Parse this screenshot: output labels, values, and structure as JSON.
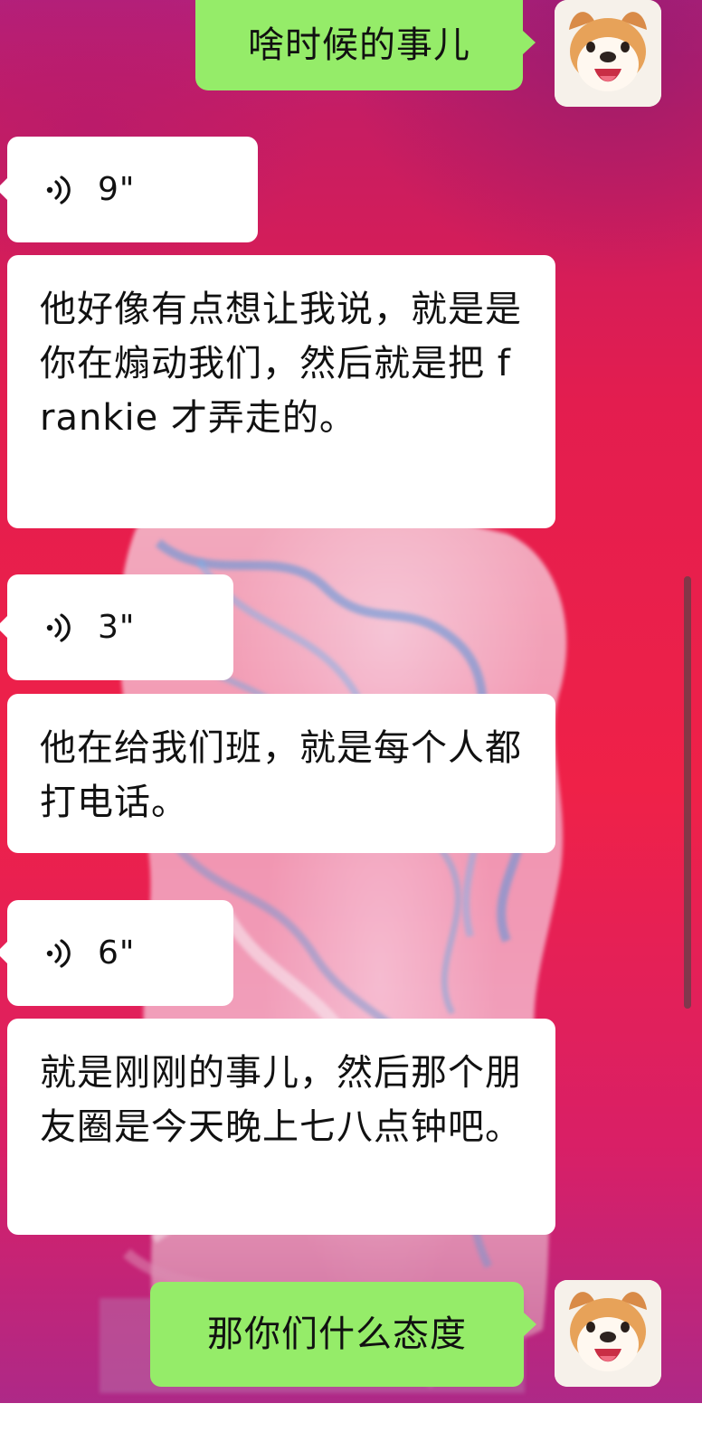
{
  "colors": {
    "outgoing_bubble": "#95ec69",
    "incoming_bubble": "#ffffff"
  },
  "conversation": {
    "messages": [
      {
        "id": "msg-out-1",
        "kind": "outgoing-text",
        "text": "啥时候的事儿"
      },
      {
        "id": "msg-voice-1",
        "kind": "incoming-voice",
        "icon": "voice-wave-icon",
        "duration": "9\""
      },
      {
        "id": "msg-transcript-1",
        "kind": "voice-transcript",
        "text": "他好像有点想让我说，就是是你在煽动我们，然后就是把 frankie 才弄走的。"
      },
      {
        "id": "msg-voice-2",
        "kind": "incoming-voice",
        "icon": "voice-wave-icon",
        "duration": "3\""
      },
      {
        "id": "msg-transcript-2",
        "kind": "voice-transcript",
        "text": "他在给我们班，就是每个人都打电话。"
      },
      {
        "id": "msg-voice-3",
        "kind": "incoming-voice",
        "icon": "voice-wave-icon",
        "duration": "6\""
      },
      {
        "id": "msg-transcript-3",
        "kind": "voice-transcript",
        "text": "就是刚刚的事儿，然后那个朋友圈是今天晚上七八点钟吧。"
      },
      {
        "id": "msg-out-2",
        "kind": "outgoing-text",
        "text": "那你们什么态度"
      }
    ]
  },
  "avatar": {
    "icon": "shiba-inu-avatar-icon"
  }
}
